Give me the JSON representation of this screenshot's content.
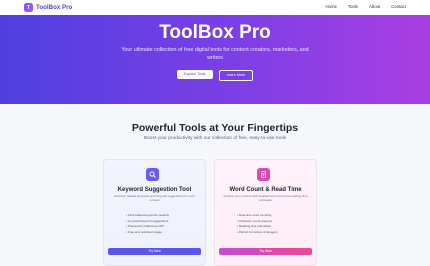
{
  "nav": {
    "logo_badge": "T",
    "logo_text": "ToolBox Pro",
    "links": [
      "Home",
      "Tools",
      "About",
      "Contact"
    ]
  },
  "hero": {
    "title": "ToolBox Pro",
    "subtitle": "Your ultimate collection of free digital tools for content creators, marketers, and writers",
    "primary_button": "Explore Tools",
    "secondary_button": "Learn More"
  },
  "section": {
    "title": "Powerful Tools at Your Fingertips",
    "subtitle": "Boost your productivity with our collection of free, easy-to-use tools"
  },
  "cards": [
    {
      "icon": "search-icon",
      "title": "Keyword Suggestion Tool",
      "description": "Discover related keywords and long-tail suggestions for your content",
      "features": [
        "• Find related keywords instantly",
        "• Long-tail keyword suggestions",
        "• Powered by Datamuse API",
        "• Free and unlimited usage"
      ],
      "button": "Try Now"
    },
    {
      "icon": "document-icon",
      "title": "Word Count & Read Time",
      "description": "Analyze your content with detailed word count and reading time estimates",
      "features": [
        "• Real-time word counting",
        "• Character count analysis",
        "• Reading time estimation",
        "• Perfect for writers & bloggers"
      ],
      "button": "Try Now"
    }
  ],
  "colors": {
    "brand": "#4c44e0",
    "hero_gradient_start": "#4f3fe0",
    "hero_gradient_end": "#a93fe2",
    "card1_accent": "#5b57ea",
    "card2_accent": "#d84ab5"
  }
}
